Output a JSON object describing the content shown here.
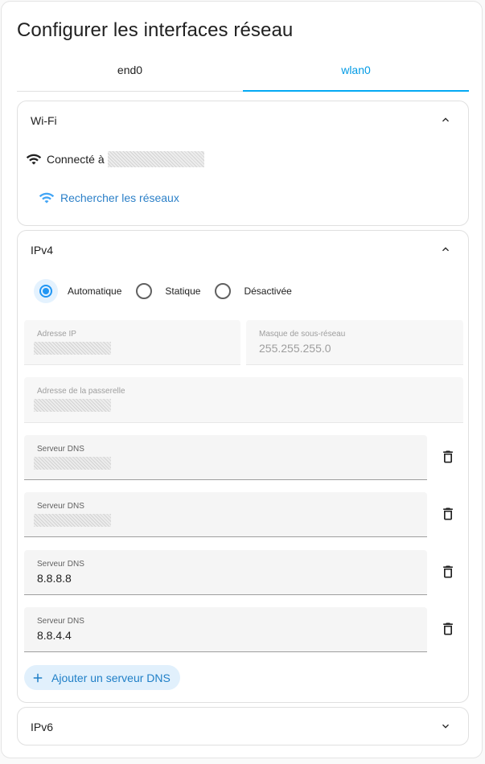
{
  "page": {
    "title": "Configurer les interfaces réseau"
  },
  "tabs": [
    {
      "label": "end0",
      "active": false
    },
    {
      "label": "wlan0",
      "active": true
    }
  ],
  "wifi": {
    "header": "Wi-Fi",
    "connected_prefix": "Connecté à",
    "scan_label": "Rechercher les réseaux"
  },
  "ipv4": {
    "header": "IPv4",
    "modes": [
      {
        "label": "Automatique",
        "checked": true
      },
      {
        "label": "Statique",
        "checked": false
      },
      {
        "label": "Désactivée",
        "checked": false
      }
    ],
    "ip_address": {
      "label": "Adresse IP",
      "value": ""
    },
    "subnet_mask": {
      "label": "Masque de sous-réseau",
      "value": "255.255.255.0"
    },
    "gateway": {
      "label": "Adresse de la passerelle",
      "value": ""
    },
    "dns": [
      {
        "label": "Serveur DNS",
        "value": ""
      },
      {
        "label": "Serveur DNS",
        "value": ""
      },
      {
        "label": "Serveur DNS",
        "value": "8.8.8.8"
      },
      {
        "label": "Serveur DNS",
        "value": "8.8.4.4"
      }
    ],
    "add_dns_label": "Ajouter un serveur DNS"
  },
  "ipv6": {
    "header": "IPv6"
  },
  "colors": {
    "accent": "#03a9f4",
    "link": "#2c80c8",
    "radio": "#2196f3",
    "chip_bg": "#e1f0fc"
  },
  "icons": {
    "expand_less": "chevron-up-icon",
    "expand_more": "chevron-down-icon",
    "wifi": "wifi-icon",
    "delete": "trash-icon",
    "add": "plus-icon"
  }
}
